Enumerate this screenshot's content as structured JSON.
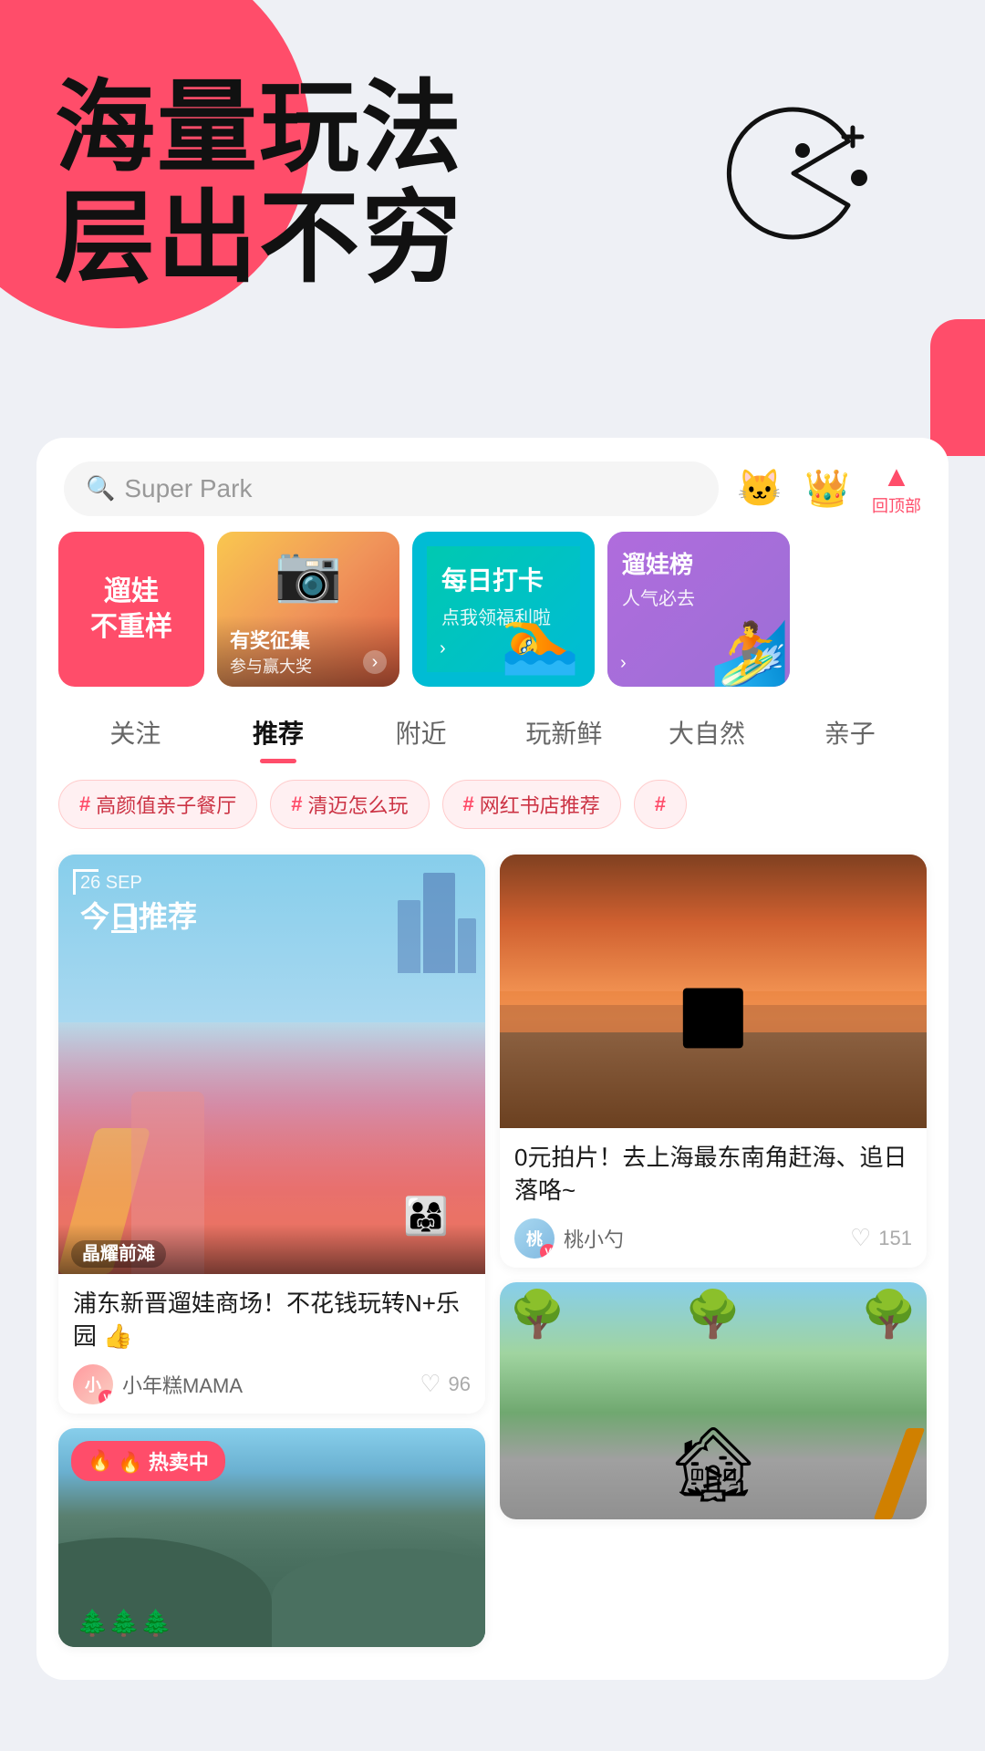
{
  "hero": {
    "title_line1": "海量玩法",
    "title_line2": "层出不穷"
  },
  "header": {
    "search_placeholder": "Super Park",
    "icon_cat": "🐱",
    "icon_crown": "👑",
    "back_top_label": "回顶部"
  },
  "banners": [
    {
      "id": 1,
      "type": "text",
      "title": "遛娃\n不重样",
      "bg_color": "#ff4d6a"
    },
    {
      "id": 2,
      "type": "image",
      "title": "有奖征集",
      "subtitle": "参与赢大奖",
      "has_arrow": true
    },
    {
      "id": 3,
      "type": "teal",
      "title": "每日打卡",
      "subtitle": "点我领福利啦",
      "has_arrow": true
    },
    {
      "id": 4,
      "type": "purple",
      "title": "遛娃榜",
      "subtitle": "人气必去",
      "has_arrow": true
    }
  ],
  "nav_tabs": [
    {
      "id": "follow",
      "label": "关注",
      "active": false
    },
    {
      "id": "recommend",
      "label": "推荐",
      "active": true
    },
    {
      "id": "nearby",
      "label": "附近",
      "active": false
    },
    {
      "id": "new",
      "label": "玩新鲜",
      "active": false
    },
    {
      "id": "nature",
      "label": "大自然",
      "active": false
    },
    {
      "id": "family",
      "label": "亲子",
      "active": false
    }
  ],
  "tags": [
    {
      "id": 1,
      "label": "高颜值亲子餐厅"
    },
    {
      "id": 2,
      "label": "清迈怎么玩"
    },
    {
      "id": 3,
      "label": "网红书店推荐"
    }
  ],
  "posts": {
    "left_column": [
      {
        "id": "post-1",
        "type": "featured",
        "date": "26 SEP",
        "today_label": "今日推荐",
        "location": "晶耀前滩",
        "title": "浦东新晋遛娃商场！不花钱玩转N+乐园 👍",
        "author": "小年糕MAMA",
        "likes": "96",
        "image_type": "playground"
      },
      {
        "id": "post-4",
        "type": "hot",
        "hot_label": "🔥 热卖中",
        "title": "",
        "image_type": "mountain"
      }
    ],
    "right_column": [
      {
        "id": "post-2",
        "type": "normal",
        "title": "0元拍片！去上海最东南角赶海、追日落咯~",
        "author": "桃小勺",
        "likes": "151",
        "image_type": "sunset"
      },
      {
        "id": "post-3",
        "type": "normal",
        "title": "",
        "image_type": "house"
      }
    ]
  }
}
